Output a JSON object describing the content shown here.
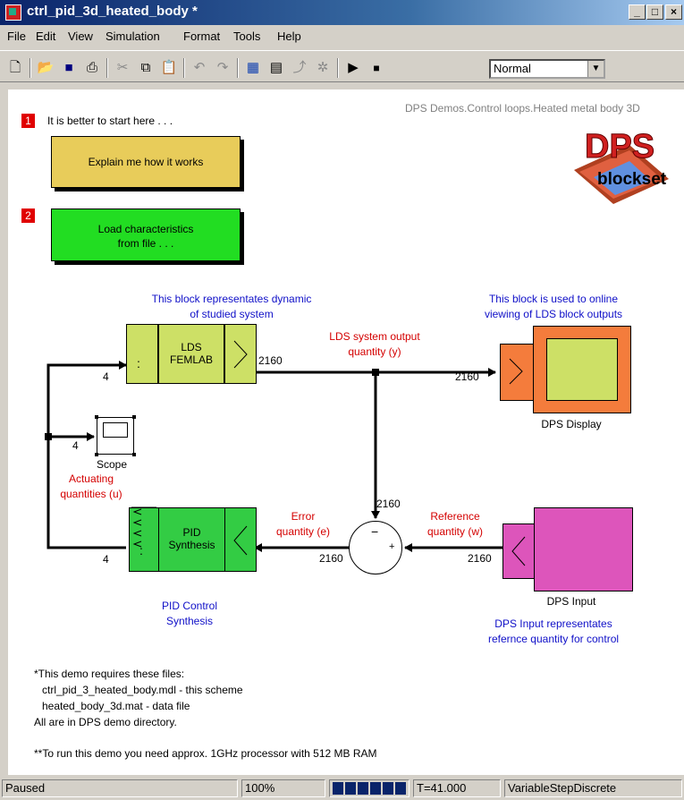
{
  "window": {
    "title": "ctrl_pid_3d_heated_body *"
  },
  "menu": [
    "File",
    "Edit",
    "View",
    "Simulation",
    "Format",
    "Tools",
    "Help"
  ],
  "toolbar": {
    "sim_mode": "Normal"
  },
  "canvas": {
    "path_label": "DPS Demos.Control loops.Heated metal body 3D",
    "logo": {
      "big": "DPS",
      "small": "blockset"
    },
    "step1": {
      "num": "1",
      "text": "It is better to start here . . .",
      "button": "Explain me how it works"
    },
    "step2": {
      "num": "2",
      "line1": "Load characteristics",
      "line2": "from file . . ."
    },
    "lds": {
      "note1": "This block representates dynamic",
      "note2": "of studied system",
      "label1": "LDS",
      "label2": "FEMLAB",
      "in_width": "4",
      "out_width": "2160",
      "dots": ":"
    },
    "output_label1": "LDS system output",
    "output_label2": "quantity (y)",
    "display": {
      "note1": "This block is used to online",
      "note2": "viewing of LDS block outputs",
      "label": "DPS Display",
      "in_width": "2160"
    },
    "scope": {
      "label": "Scope",
      "in_width": "4"
    },
    "actuating1": "Actuating",
    "actuating2": "quantities (u)",
    "pid": {
      "label1": "PID",
      "label2": "Synthesis",
      "out_width": "4",
      "caption1": "PID Control",
      "caption2": "Synthesis",
      "dots": ":"
    },
    "error_label1": "Error",
    "error_label2": "quantity (e)",
    "error_width": "2160",
    "feedback_width": "2160",
    "sum": {
      "minus": "−",
      "plus": "+"
    },
    "reference_label1": "Reference",
    "reference_label2": "quantity (w)",
    "reference_width": "2160",
    "dps_input": {
      "label": "DPS Input",
      "note1": "DPS Input representates",
      "note2": "refernce quantity for control"
    },
    "notes": [
      "*This demo requires these files:",
      "ctrl_pid_3_heated_body.mdl - this scheme",
      "heated_body_3d.mat - data file",
      "All are in DPS demo directory."
    ],
    "footnote": "**To run this demo you need approx. 1GHz processor with 512 MB RAM"
  },
  "status": {
    "state": "Paused",
    "zoom": "100%",
    "progress": 1.0,
    "time": "T=41.000",
    "solver": "VariableStepDiscrete"
  },
  "colors": {
    "yellow_button": "#e8cc5a",
    "green_button": "#22dd22",
    "lds_block": "#cde066",
    "display_block": "#f47c3c",
    "pid_block": "#33cc44",
    "input_block": "#dd55bb"
  }
}
